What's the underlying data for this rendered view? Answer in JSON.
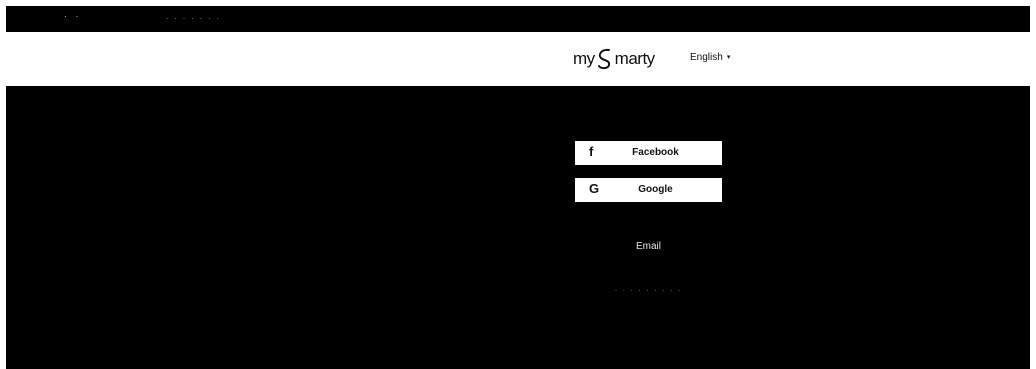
{
  "topbar": {
    "dots": "  · ·",
    "text": ". . . . . . ."
  },
  "header": {
    "logo_pre": "my",
    "logo_post": "marty",
    "language": "English",
    "language_caret": "▾"
  },
  "login": {
    "facebook_icon": "f",
    "facebook_label": "Facebook",
    "google_icon": "G",
    "google_label": "Google",
    "email_label": "Email",
    "footnote": ". . . . . . . . ."
  },
  "colors": {
    "background": "#000000",
    "header_bg": "#ffffff",
    "button_bg": "#ffffff"
  },
  "icons": [
    "facebook-icon",
    "google-icon",
    "caret-down-icon",
    "logo-swirl-icon"
  ]
}
